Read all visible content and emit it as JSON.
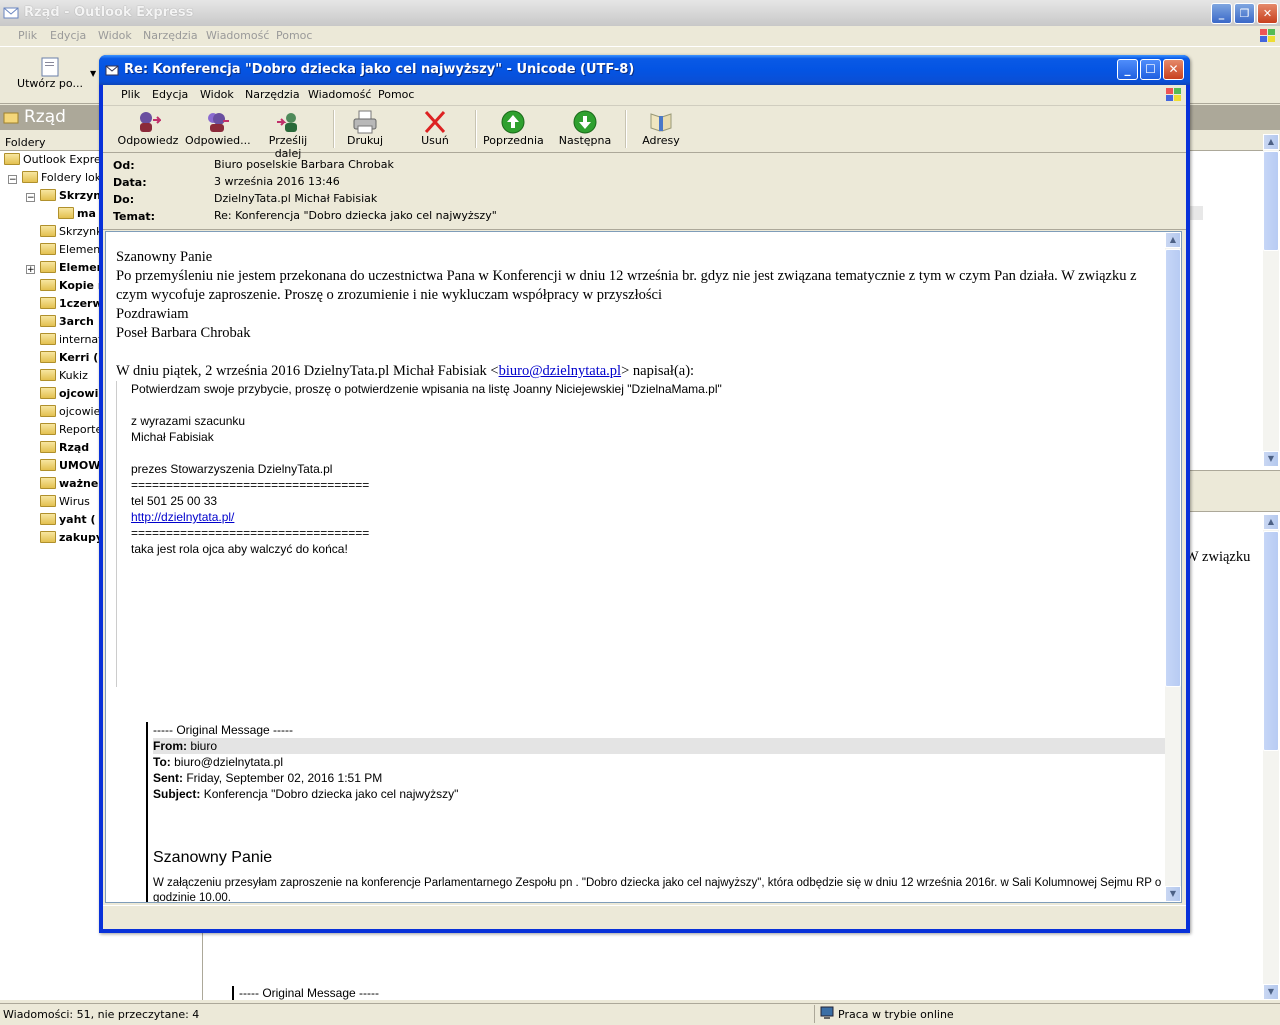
{
  "bg_window": {
    "title": "Rząd - Outlook Express",
    "menu": [
      "Plik",
      "Edycja",
      "Widok",
      "Narzędzia",
      "Wiadomość",
      "Pomoc"
    ],
    "toolbar_create": "Utwórz po...",
    "folder_title": "Rząd",
    "folders_header": "Foldery",
    "tree": [
      {
        "label": "Outlook Express",
        "bold": false
      },
      {
        "label": "Foldery loka",
        "bold": false
      },
      {
        "label": "Skrzyn",
        "bold": true
      },
      {
        "label": "ma",
        "bold": true
      },
      {
        "label": "Skrzynk",
        "bold": false
      },
      {
        "label": "Element",
        "bold": false
      },
      {
        "label": "Elemen",
        "bold": true
      },
      {
        "label": "Kopie r",
        "bold": true
      },
      {
        "label": "1czerw",
        "bold": true
      },
      {
        "label": "3arch",
        "bold": true
      },
      {
        "label": "internat",
        "bold": false
      },
      {
        "label": "Kerri (",
        "bold": true
      },
      {
        "label": "Kukiz",
        "bold": false
      },
      {
        "label": "ojcowi",
        "bold": true
      },
      {
        "label": "ojcowie",
        "bold": false
      },
      {
        "label": "Reporte",
        "bold": false
      },
      {
        "label": "Rząd",
        "bold": true
      },
      {
        "label": "UMOW",
        "bold": true
      },
      {
        "label": "ważne",
        "bold": true
      },
      {
        "label": "Wirus",
        "bold": false
      },
      {
        "label": "yaht (",
        "bold": true
      },
      {
        "label": "zakupy",
        "bold": true
      }
    ],
    "right_snippet": "W związku",
    "right_bottom_original": "----- Original Message -----",
    "status_messages": "Wiadomości: 51, nie przeczytane: 4",
    "status_online": "Praca w trybie online"
  },
  "msg_window": {
    "title": "Re: Konferencja \"Dobro dziecka jako cel najwyższy\" - Unicode (UTF-8)",
    "menu": [
      "Plik",
      "Edycja",
      "Widok",
      "Narzędzia",
      "Wiadomość",
      "Pomoc"
    ],
    "toolbar": {
      "reply": "Odpowiedz",
      "reply_all": "Odpowied...",
      "forward": "Prześlij dalej",
      "print": "Drukuj",
      "delete": "Usuń",
      "previous": "Poprzednia",
      "next": "Następna",
      "addresses": "Adresy"
    },
    "headers": {
      "from_label": "Od:",
      "from": "Biuro poselskie Barbara Chrobak",
      "date_label": "Data:",
      "date": "3 września 2016 13:46",
      "to_label": "Do:",
      "to": "DzielnyTata.pl Michał Fabisiak",
      "subject_label": "Temat:",
      "subject": "Re: Konferencja \"Dobro dziecka jako cel najwyższy\""
    },
    "body": {
      "greeting": "Szanowny Panie",
      "para1": "Po przemyśleniu nie jestem przekonana do uczestnictwa Pana w Konferencji w dniu 12 września br. gdyz nie jest związana tematycznie z tym w czym Pan działa. W związku z czym wycofuje zaproszenie. Proszę o zrozumienie i nie wykluczam współpracy w przyszłości",
      "regards": "Pozdrawiam",
      "signature": "Poseł Barbara Chrobak",
      "quote_intro_pre": "W dniu piątek, 2 września 2016 DzielnyTata.pl Michał Fabisiak <",
      "quote_email": "biuro@dzielnytata.pl",
      "quote_intro_post": "> napisał(a):",
      "q1": "Potwierdzam swoje przybycie, proszę o potwierdzenie wpisania na listę Joanny Niciejewskiej \"DzielnaMama.pl\"",
      "q2": "z wyrazami szacunku",
      "q3": "Michał Fabisiak",
      "q4": "prezes Stowarzyszenia DzielnyTata.pl",
      "q5": "==================================",
      "q6": "tel 501 25 00 33",
      "q7": "http://dzielnytata.pl/",
      "q8": "==================================",
      "q9": "taka jest rola ojca aby walczyć do końca!",
      "orig_header": "----- Original Message -----",
      "orig_from_label": "From:",
      "orig_from": "biuro",
      "orig_to_label": "To:",
      "orig_to": "biuro@dzielnytata.pl",
      "orig_sent_label": "Sent:",
      "orig_sent": "Friday, September 02, 2016 1:51 PM",
      "orig_subject_label": "Subject:",
      "orig_subject": "Konferencja \"Dobro dziecka jako cel najwyższy\"",
      "orig_greeting": "Szanowny Panie",
      "orig_para": "W załączeniu przesyłam zaproszenie na konferencje Parlamentarnego Zespołu pn . \"Dobro dziecka jako cel najwyższy\", która odbędzie się w dniu 12 września 2016r. w Sali Kolumnowej Sejmu RP o godzinie 10.00."
    }
  }
}
